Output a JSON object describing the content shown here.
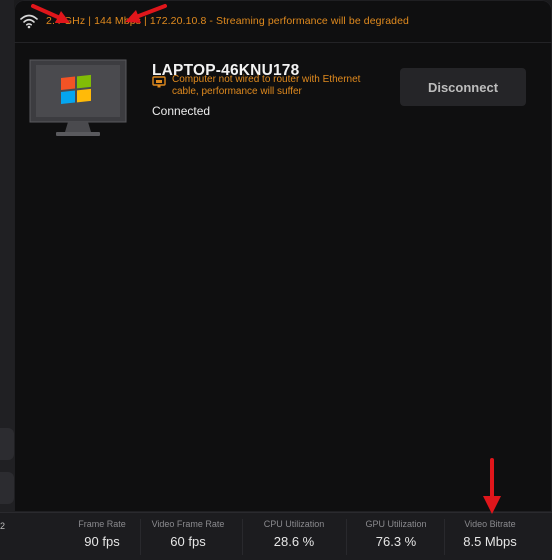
{
  "status_bar": {
    "icon": "wifi-icon",
    "text": "2.4 GHz | 144 Mbps | 172.20.10.8 - Streaming performance will be degraded",
    "color": "#e08a1e"
  },
  "host": {
    "icon": "monitor-windows-icon",
    "name": "LAPTOP-46KNU178",
    "warning_icon": "ethernet-warning-icon",
    "warning": "Computer not wired to router with Ethernet cable, performance will suffer",
    "status": "Connected",
    "disconnect_label": "Disconnect"
  },
  "stats": {
    "cut_off_value": "2",
    "items": [
      {
        "label": "Frame Rate",
        "value": "90 fps"
      },
      {
        "label": "Video Frame Rate",
        "value": "60 fps"
      },
      {
        "label": "CPU Utilization",
        "value": "28.6 %"
      },
      {
        "label": "GPU Utilization",
        "value": "76.3 %"
      },
      {
        "label": "Video Bitrate",
        "value": "8.5 Mbps"
      }
    ]
  },
  "colors": {
    "warning": "#e08a1e",
    "annotation_arrow": "#e0161b",
    "panel_bg": "#0f0f10",
    "windows_red": "#f35325",
    "windows_green": "#81bc06",
    "windows_blue": "#05a6f0",
    "windows_yellow": "#ffba08"
  }
}
